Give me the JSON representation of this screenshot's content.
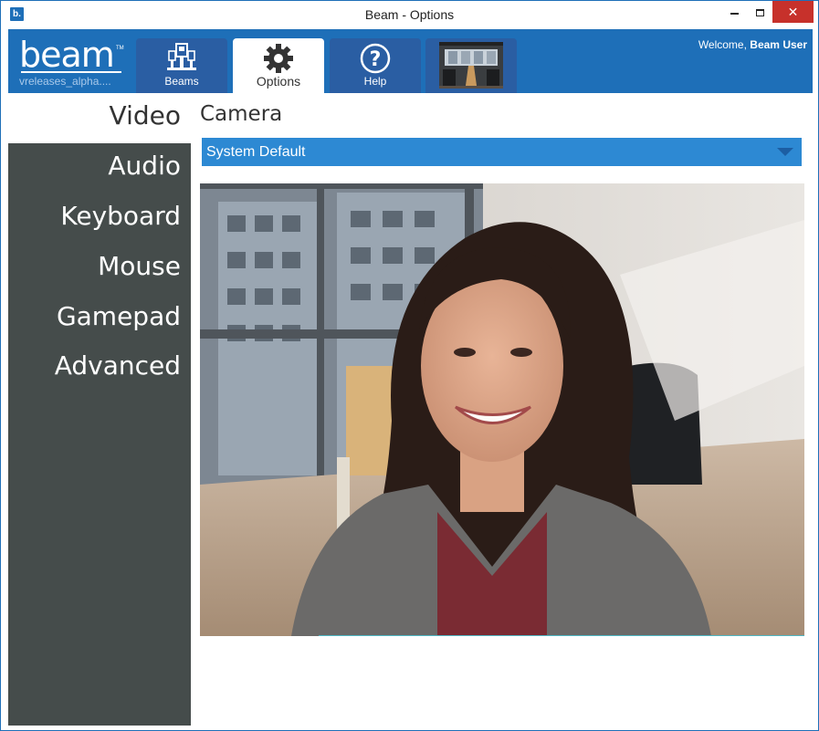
{
  "window": {
    "title": "Beam - Options",
    "app_icon_glyph": "b.",
    "controls": {
      "minimize_icon": "minimize-icon",
      "maximize_icon": "maximize-icon",
      "close_glyph": "✕"
    }
  },
  "header": {
    "logo_text": "beam",
    "logo_tm": "TM",
    "build_label": "vreleases_alpha....",
    "welcome_prefix": "Welcome,",
    "user_name": "Beam User",
    "tabs": [
      {
        "label": "Beams",
        "icon": "beams-icon",
        "active": false
      },
      {
        "label": "Options",
        "icon": "gear-icon",
        "active": true
      },
      {
        "label": "Help",
        "icon": "help-icon",
        "active": false
      },
      {
        "label": "",
        "icon": "remote-preview-thumbnail",
        "active": false
      }
    ]
  },
  "sidebar": {
    "items": [
      {
        "label": "Video",
        "active": true
      },
      {
        "label": "Audio",
        "active": false
      },
      {
        "label": "Keyboard",
        "active": false
      },
      {
        "label": "Mouse",
        "active": false
      },
      {
        "label": "Gamepad",
        "active": false
      },
      {
        "label": "Advanced",
        "active": false
      }
    ]
  },
  "main": {
    "section_title": "Camera",
    "camera_select": {
      "selected": "System Default",
      "arrow_icon": "chevron-down-icon"
    }
  },
  "colors": {
    "brand_blue": "#1e6fb8",
    "tab_blue": "#2a5ea3",
    "dropdown_blue": "#2d89d3",
    "sidebar_gray": "#454c4b",
    "close_red": "#c7312b"
  }
}
